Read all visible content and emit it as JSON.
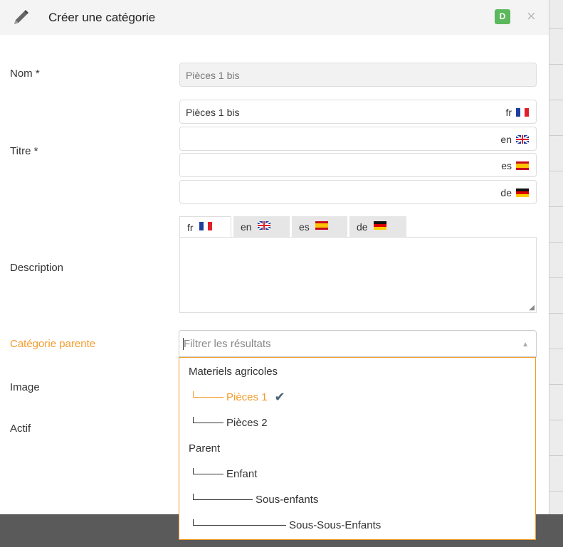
{
  "header": {
    "title": "Créer une catégorie",
    "badge": "D",
    "close_glyph": "×"
  },
  "labels": {
    "nom": "Nom *",
    "titre": "Titre *",
    "description": "Description",
    "categorie_parente": "Catégorie parente",
    "image": "Image",
    "actif": "Actif"
  },
  "nom_field": {
    "value": "Pièces 1 bis"
  },
  "titre_fields": [
    {
      "value": "Pièces 1 bis",
      "lang": "fr",
      "flag": "fr"
    },
    {
      "value": "",
      "lang": "en",
      "flag": "en"
    },
    {
      "value": "",
      "lang": "es",
      "flag": "es"
    },
    {
      "value": "",
      "lang": "de",
      "flag": "de"
    }
  ],
  "description_tabs": [
    {
      "label": "fr",
      "flag": "fr",
      "active": true
    },
    {
      "label": "en",
      "flag": "en",
      "active": false
    },
    {
      "label": "es",
      "flag": "es",
      "active": false
    },
    {
      "label": "de",
      "flag": "de",
      "active": false
    }
  ],
  "parent_select": {
    "placeholder": "Filtrer les résultats",
    "caret": "▲"
  },
  "options": [
    {
      "label": "Materiels agricoles",
      "type": "group"
    },
    {
      "label": "Pièces 1",
      "type": "child",
      "level": 1,
      "selected": true
    },
    {
      "label": "Pièces 2",
      "type": "child",
      "level": 1
    },
    {
      "label": "Parent",
      "type": "group"
    },
    {
      "label": "Enfant",
      "type": "child",
      "level": 1
    },
    {
      "label": "Sous-enfants",
      "type": "child",
      "level": 2
    },
    {
      "label": "Sous-Sous-Enfants",
      "type": "child",
      "level": 3
    }
  ],
  "colors": {
    "accent": "#f29b2b",
    "badge": "#5cb85c"
  }
}
